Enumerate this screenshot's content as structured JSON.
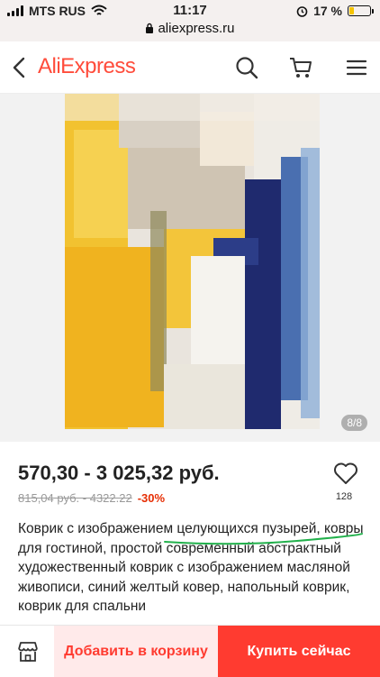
{
  "status_bar": {
    "carrier": "MTS RUS",
    "time": "11:17",
    "url": "aliexpress.ru",
    "battery": "17 %",
    "battery_level": 0.17
  },
  "header": {
    "logo": "AliExpress",
    "icons": [
      "back-icon",
      "search-icon",
      "cart-icon",
      "menu-icon"
    ]
  },
  "gallery": {
    "counter": "8/8"
  },
  "product": {
    "price": "570,30 - 3 025,32 руб.",
    "old_price": "815,04 руб. - 4322.22",
    "discount": "-30%",
    "favorites_count": "128",
    "description": "Коврик с изображением целующихся пузырей, ковры для гостиной, простой современный абстрактный художественный коврик с изображением масляной живописи, синий желтый ковер, напольный коврик, коврик для спальни"
  },
  "bottom_bar": {
    "add_to_cart": "Добавить в корзину",
    "buy_now": "Купить сейчас"
  },
  "colors": {
    "brand": "#ff4c3b",
    "buy_button": "#ff3b30",
    "cart_button_bg": "#ffeaea",
    "discount": "#e62e04",
    "annotation": "#22b14c"
  }
}
